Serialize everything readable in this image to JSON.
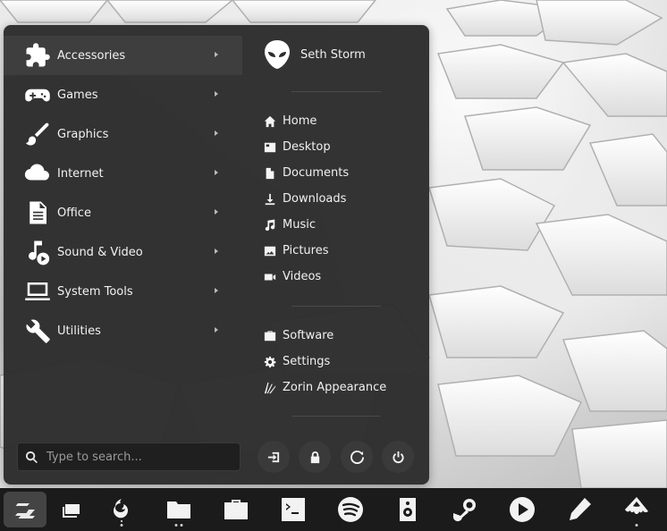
{
  "menu": {
    "categories": [
      {
        "label": "Accessories",
        "icon": "puzzle-icon"
      },
      {
        "label": "Games",
        "icon": "gamepad-icon"
      },
      {
        "label": "Graphics",
        "icon": "brush-icon"
      },
      {
        "label": "Internet",
        "icon": "cloud-icon"
      },
      {
        "label": "Office",
        "icon": "document-icon"
      },
      {
        "label": "Sound & Video",
        "icon": "music-play-icon"
      },
      {
        "label": "System Tools",
        "icon": "laptop-icon"
      },
      {
        "label": "Utilities",
        "icon": "wrench-icon"
      }
    ],
    "active_category": "Accessories",
    "user": {
      "name": "Seth Storm",
      "avatar_icon": "alien-avatar-icon"
    },
    "places": [
      {
        "label": "Home",
        "icon": "home-icon"
      },
      {
        "label": "Desktop",
        "icon": "desktop-icon"
      },
      {
        "label": "Documents",
        "icon": "file-icon"
      },
      {
        "label": "Downloads",
        "icon": "download-icon"
      },
      {
        "label": "Music",
        "icon": "music-note-icon"
      },
      {
        "label": "Pictures",
        "icon": "image-icon"
      },
      {
        "label": "Videos",
        "icon": "video-camera-icon"
      }
    ],
    "system": [
      {
        "label": "Software",
        "icon": "bag-icon"
      },
      {
        "label": "Settings",
        "icon": "gear-icon"
      },
      {
        "label": "Zorin Appearance",
        "icon": "appearance-icon"
      }
    ],
    "search": {
      "placeholder": "Type to search..."
    },
    "power_buttons": [
      "logout-icon",
      "lock-icon",
      "restart-icon",
      "power-icon"
    ]
  },
  "taskbar": {
    "items": [
      "zorin-menu-icon",
      "window-switcher-icon",
      "firefox-icon",
      "files-icon",
      "software-icon",
      "terminal-icon",
      "spotify-icon",
      "speaker-icon",
      "steam-icon",
      "media-player-icon",
      "pencil-icon",
      "inkscape-icon"
    ]
  },
  "colors": {
    "menu_bg": "#2c2c2c",
    "active_item": "#3e3e3e",
    "taskbar_bg": "#1b1b1b"
  }
}
